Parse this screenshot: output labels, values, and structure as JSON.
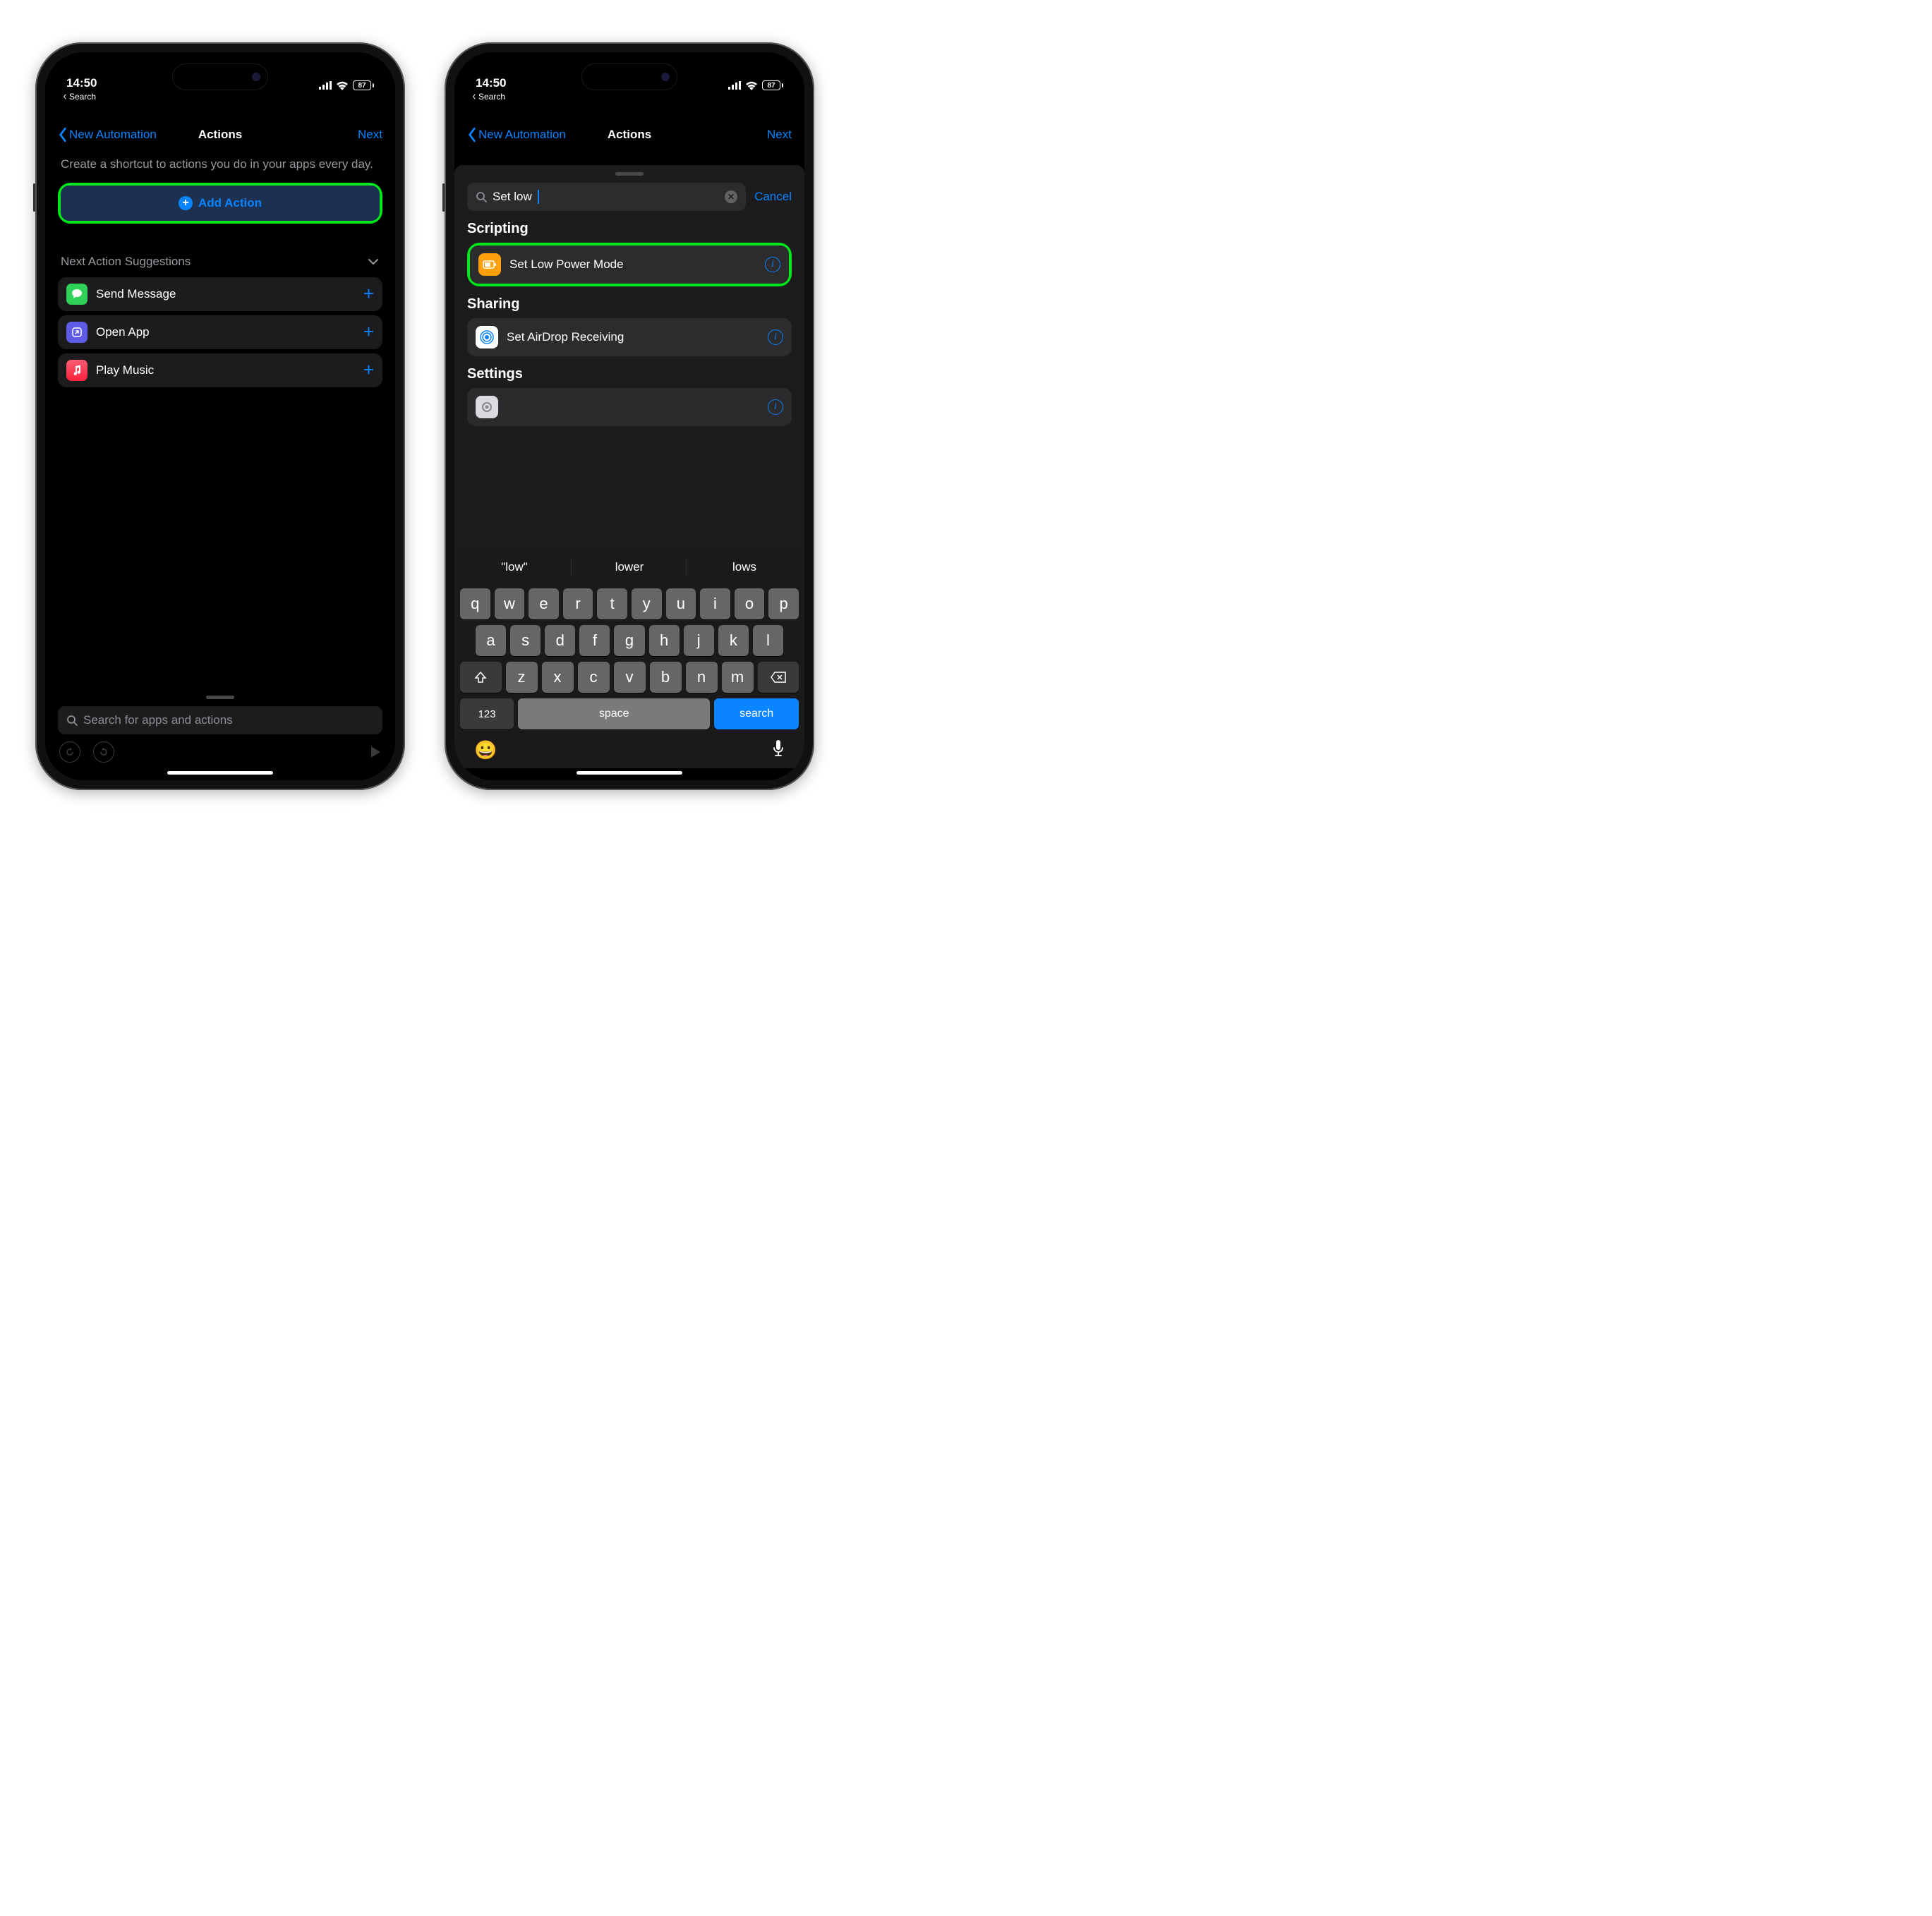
{
  "status": {
    "time": "14:50",
    "back_label": "Search",
    "battery": "87"
  },
  "nav": {
    "back": "New Automation",
    "title": "Actions",
    "next": "Next"
  },
  "left": {
    "intro": "Create a shortcut to actions you do in your apps every day.",
    "add_action": "Add Action",
    "suggestions_title": "Next Action Suggestions",
    "suggestions": [
      {
        "label": "Send Message",
        "icon_bg": "#30d158"
      },
      {
        "label": "Open App",
        "icon_bg": "#5e5ce6"
      },
      {
        "label": "Play Music",
        "icon_bg": "#ff2d55"
      }
    ],
    "search_placeholder": "Search for apps and actions"
  },
  "right": {
    "search_value": "Set low",
    "cancel": "Cancel",
    "sections": {
      "scripting": {
        "title": "Scripting",
        "item": "Set Low Power Mode"
      },
      "sharing": {
        "title": "Sharing",
        "item": "Set AirDrop Receiving"
      },
      "settings": {
        "title": "Settings"
      }
    },
    "suggestions": [
      "\"low\"",
      "lower",
      "lows"
    ],
    "keys_row1": [
      "q",
      "w",
      "e",
      "r",
      "t",
      "y",
      "u",
      "i",
      "o",
      "p"
    ],
    "keys_row2": [
      "a",
      "s",
      "d",
      "f",
      "g",
      "h",
      "j",
      "k",
      "l"
    ],
    "keys_row3": [
      "z",
      "x",
      "c",
      "v",
      "b",
      "n",
      "m"
    ],
    "num_key": "123",
    "space_key": "space",
    "search_key": "search"
  }
}
